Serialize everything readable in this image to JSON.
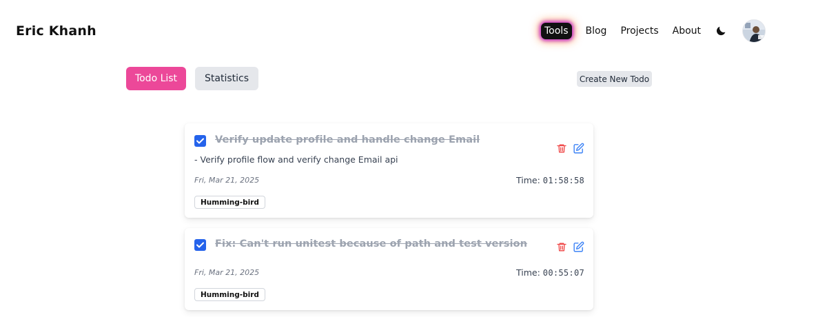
{
  "header": {
    "brand": "Eric Khanh",
    "nav": [
      "Tools",
      "Blog",
      "Projects",
      "About"
    ],
    "theme_icon": "moon-icon",
    "avatar_icon": "avatar"
  },
  "toolbar": {
    "tab_todo": "Todo List",
    "tab_statistics": "Statistics",
    "create_button": "Create New Todo",
    "active_tab_color": "#ec4899"
  },
  "todos": [
    {
      "title": "Verify update profile and handle change Email",
      "description": "- Verify profile flow and verify change Email api",
      "date": "Fri, Mar 21, 2025",
      "time_label": "Time:",
      "time": "01:58:58",
      "tag": "Humming-bird",
      "completed": true,
      "delete_icon": "trash-icon",
      "edit_icon": "edit-icon"
    },
    {
      "title": "Fix: Can't run unitest because of path and test version",
      "description": "",
      "date": "Fri, Mar 21, 2025",
      "time_label": "Time:",
      "time": "00:55:07",
      "tag": "Humming-bird",
      "completed": true,
      "delete_icon": "trash-icon",
      "edit_icon": "edit-icon"
    }
  ],
  "colors": {
    "checkbox": "#2563eb",
    "delete_icon": "#ef4444",
    "edit_icon": "#3b82f6"
  }
}
